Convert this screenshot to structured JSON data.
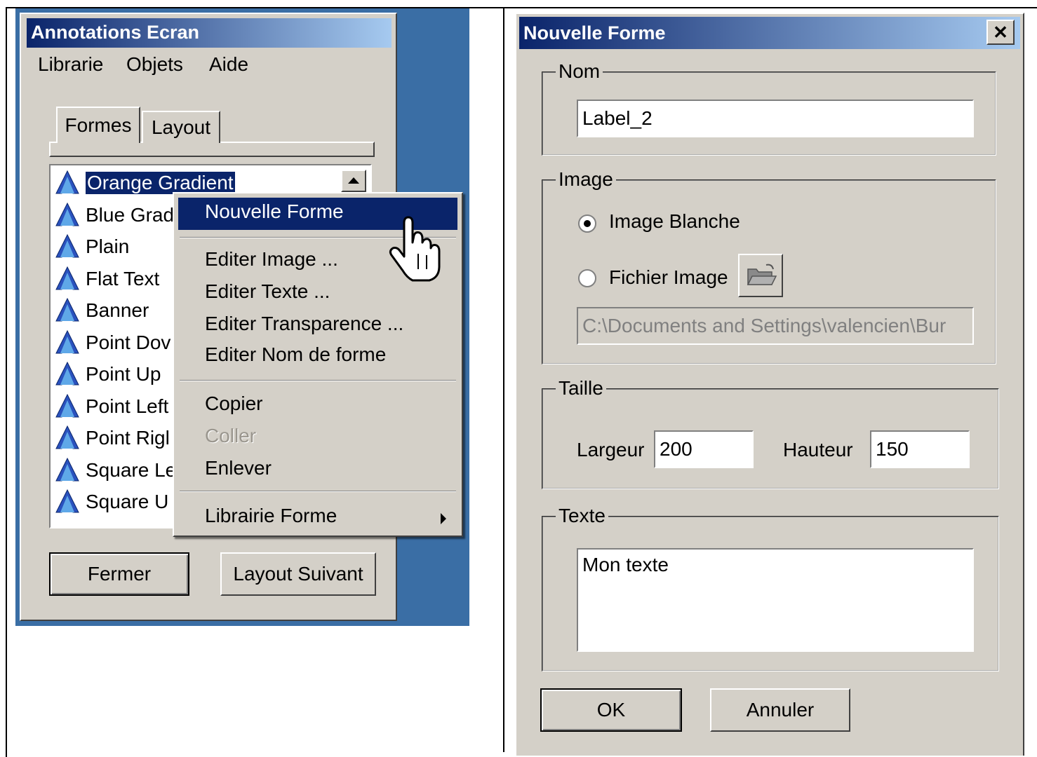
{
  "left_window": {
    "title": "Annotations Ecran",
    "menu": [
      "Librarie",
      "Objets",
      "Aide"
    ],
    "tabs": [
      "Formes",
      "Layout"
    ],
    "list_items": [
      "Orange Gradient",
      "Blue Grad",
      "Plain",
      "Flat Text",
      "Banner",
      "Point Dov",
      "Point Up",
      "Point Left",
      "Point Rigl",
      "Square Le",
      "Square U"
    ],
    "buttons": {
      "close": "Fermer",
      "next_layout": "Layout Suivant"
    }
  },
  "context_menu": {
    "items": [
      {
        "label": "Nouvelle Forme",
        "state": "highlighted"
      },
      {
        "label": "Editer Image ...",
        "state": "normal"
      },
      {
        "label": "Editer Texte ...",
        "state": "normal"
      },
      {
        "label": "Editer Transparence ...",
        "state": "normal"
      },
      {
        "label": "Editer Nom de forme",
        "state": "normal"
      },
      {
        "label": "Copier",
        "state": "normal"
      },
      {
        "label": "Coller",
        "state": "disabled"
      },
      {
        "label": "Enlever",
        "state": "normal"
      },
      {
        "label": "Librairie Forme",
        "state": "submenu"
      }
    ]
  },
  "dialog": {
    "title": "Nouvelle Forme",
    "close_glyph": "✕",
    "nom": {
      "legend": "Nom",
      "value": "Label_2"
    },
    "image": {
      "legend": "Image",
      "option_blank": "Image Blanche",
      "option_file": "Fichier Image",
      "selected": "Image Blanche",
      "path": "C:\\Documents and Settings\\valencien\\Bur"
    },
    "taille": {
      "legend": "Taille",
      "width_label": "Largeur",
      "width_value": "200",
      "height_label": "Hauteur",
      "height_value": "150"
    },
    "texte": {
      "legend": "Texte",
      "value": "Mon texte"
    },
    "buttons": {
      "ok": "OK",
      "cancel": "Annuler"
    }
  },
  "colors": {
    "selection": "#0a246a",
    "desktop": "#3a6ea5",
    "face": "#d4d0c8"
  }
}
